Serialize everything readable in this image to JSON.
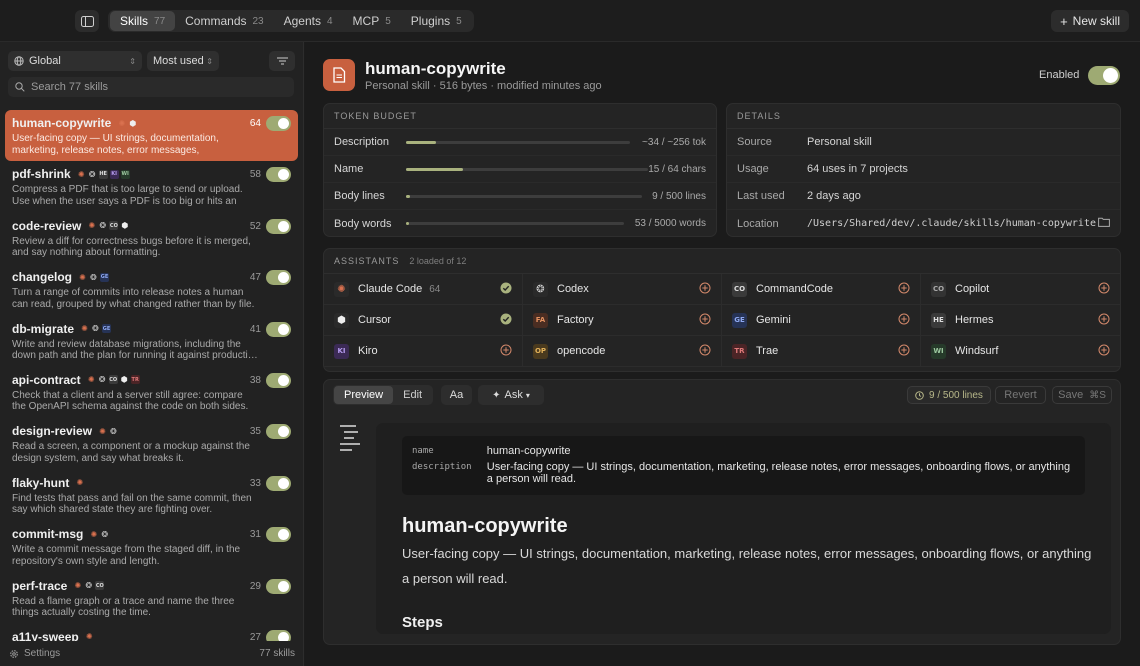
{
  "tabs": [
    {
      "label": "Skills",
      "count": "77"
    },
    {
      "label": "Commands",
      "count": "23"
    },
    {
      "label": "Agents",
      "count": "4"
    },
    {
      "label": "MCP",
      "count": "5"
    },
    {
      "label": "Plugins",
      "count": "5"
    }
  ],
  "new_skill_label": "New skill",
  "scope_select": "Global",
  "sort_select": "Most used",
  "search_placeholder": "Search 77 skills",
  "skills": [
    {
      "name": "human-copywrite",
      "count": "64",
      "desc": "User-facing copy — UI strings, documentation, marketing, release notes, error messages, onboarding…",
      "assistants": [
        "claude",
        "cursor"
      ]
    },
    {
      "name": "pdf-shrink",
      "count": "58",
      "desc": "Compress a PDF that is too large to send or upload. Use when the user says a PDF is too big or hits an att…",
      "assistants": [
        "claude",
        "codex",
        "hermes",
        "kiro",
        "windsurf"
      ]
    },
    {
      "name": "code-review",
      "count": "52",
      "desc": "Review a diff for correctness bugs before it is merged, and say nothing about formatting.",
      "assistants": [
        "claude",
        "codex",
        "commandcode",
        "cursor"
      ]
    },
    {
      "name": "changelog",
      "count": "47",
      "desc": "Turn a range of commits into release notes a human can read, grouped by what changed rather than by file.",
      "assistants": [
        "claude",
        "codex",
        "gemini"
      ]
    },
    {
      "name": "db-migrate",
      "count": "41",
      "desc": "Write and review database migrations, including the down path and the plan for running it against producti…",
      "assistants": [
        "claude",
        "codex",
        "gemini"
      ]
    },
    {
      "name": "api-contract",
      "count": "38",
      "desc": "Check that a client and a server still agree: compare the OpenAPI schema against the code on both sides.",
      "assistants": [
        "claude",
        "codex",
        "commandcode",
        "cursor",
        "trae"
      ]
    },
    {
      "name": "design-review",
      "count": "35",
      "desc": "Read a screen, a component or a mockup against the design system, and say what breaks it.",
      "assistants": [
        "claude",
        "codex"
      ]
    },
    {
      "name": "flaky-hunt",
      "count": "33",
      "desc": "Find tests that pass and fail on the same commit, then say which shared state they are fighting over.",
      "assistants": [
        "claude"
      ]
    },
    {
      "name": "commit-msg",
      "count": "31",
      "desc": "Write a commit message from the staged diff, in the repository's own style and length.",
      "assistants": [
        "claude",
        "codex"
      ]
    },
    {
      "name": "perf-trace",
      "count": "29",
      "desc": "Read a flame graph or a trace and name the three things actually costing the time.",
      "assistants": [
        "claude",
        "codex",
        "commandcode"
      ]
    },
    {
      "name": "a11y-sweep",
      "count": "27",
      "desc": "",
      "assistants": [
        "claude"
      ]
    }
  ],
  "footer": {
    "settings": "Settings",
    "count": "77 skills"
  },
  "header": {
    "title": "human-copywrite",
    "subtitle": "Personal skill · 516 bytes · modified minutes ago",
    "enabled_label": "Enabled",
    "enabled": true
  },
  "token_budget": {
    "title": "TOKEN BUDGET",
    "rows": [
      {
        "label": "Description",
        "value": "~34 / ~256 tok",
        "fraction": 0.133
      },
      {
        "label": "Name",
        "value": "15 / 64 chars",
        "fraction": 0.234
      },
      {
        "label": "Body lines",
        "value": "9 / 500 lines",
        "fraction": 0.018
      },
      {
        "label": "Body words",
        "value": "53 / 5000 words",
        "fraction": 0.011
      }
    ]
  },
  "details": {
    "title": "DETAILS",
    "rows": [
      {
        "label": "Source",
        "value": "Personal skill"
      },
      {
        "label": "Usage",
        "value": "64 uses in 7 projects"
      },
      {
        "label": "Last used",
        "value": "2 days ago"
      },
      {
        "label": "Location",
        "value": "/Users/Shared/dev/.claude/skills/human-copywrite"
      }
    ]
  },
  "assistants_panel": {
    "title": "ASSISTANTS",
    "subtitle": "2 loaded of 12",
    "items": [
      {
        "name": "Claude Code",
        "count": "64",
        "logo": "claude",
        "status": "loaded"
      },
      {
        "name": "Codex",
        "count": "",
        "logo": "codex",
        "status": "add"
      },
      {
        "name": "CommandCode",
        "count": "",
        "logo": "commandcode",
        "status": "add"
      },
      {
        "name": "Copilot",
        "count": "",
        "logo": "copilot",
        "status": "add"
      },
      {
        "name": "Cursor",
        "count": "",
        "logo": "cursor",
        "status": "loaded"
      },
      {
        "name": "Factory",
        "count": "",
        "logo": "factory",
        "status": "add"
      },
      {
        "name": "Gemini",
        "count": "",
        "logo": "gemini",
        "status": "add"
      },
      {
        "name": "Hermes",
        "count": "",
        "logo": "hermes",
        "status": "add"
      },
      {
        "name": "Kiro",
        "count": "",
        "logo": "kiro",
        "status": "add"
      },
      {
        "name": "opencode",
        "count": "",
        "logo": "opencode",
        "status": "add"
      },
      {
        "name": "Trae",
        "count": "",
        "logo": "trae",
        "status": "add"
      },
      {
        "name": "Windsurf",
        "count": "",
        "logo": "windsurf",
        "status": "add"
      }
    ]
  },
  "logo_text": {
    "claude": "",
    "codex": "",
    "commandcode": "CO",
    "copilot": "CO",
    "cursor": "",
    "factory": "FA",
    "gemini": "GE",
    "hermes": "HE",
    "kiro": "KI",
    "opencode": "OP",
    "trae": "TR",
    "windsurf": "WI"
  },
  "colors": {
    "accent": "#c8603f",
    "toggle_on": "#9eaa73",
    "loaded": "#a9b27e"
  },
  "editor": {
    "preview_label": "Preview",
    "edit_label": "Edit",
    "font_label": "Aa",
    "ask_label": "Ask",
    "lines_label": "9 / 500 lines",
    "revert_label": "Revert",
    "save_label": "Save",
    "save_shortcut": "⌘S"
  },
  "document": {
    "frontmatter": [
      {
        "key": "name",
        "value": "human-copywrite"
      },
      {
        "key": "description",
        "value": "User-facing copy — UI strings, documentation, marketing, release notes, error messages, onboarding flows, or anything a person will read."
      }
    ],
    "title": "human-copywrite",
    "body": "User-facing copy — UI strings, documentation, marketing, release notes, error messages, onboarding flows, or anything a person will read.",
    "next_heading": "Steps"
  }
}
